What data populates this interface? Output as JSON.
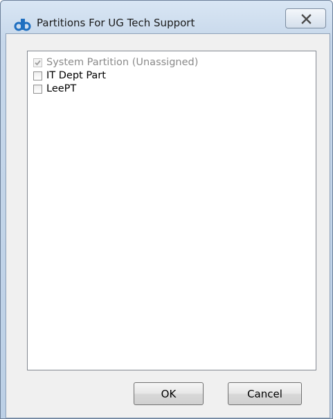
{
  "window": {
    "title": "Partitions For UG Tech Support",
    "logo_text": "db"
  },
  "partitions": {
    "items": [
      {
        "label": "System Partition (Unassigned)",
        "checked": true,
        "disabled": true
      },
      {
        "label": "IT Dept Part",
        "checked": false,
        "disabled": false
      },
      {
        "label": "LeePT",
        "checked": false,
        "disabled": false
      }
    ]
  },
  "buttons": {
    "ok_label": "OK",
    "cancel_label": "Cancel"
  },
  "icons": {
    "close": "close-icon",
    "checkmark": "checkmark-icon"
  },
  "colors": {
    "logo_blue": "#1f6fc0",
    "close_x": "#4a4a4a"
  }
}
